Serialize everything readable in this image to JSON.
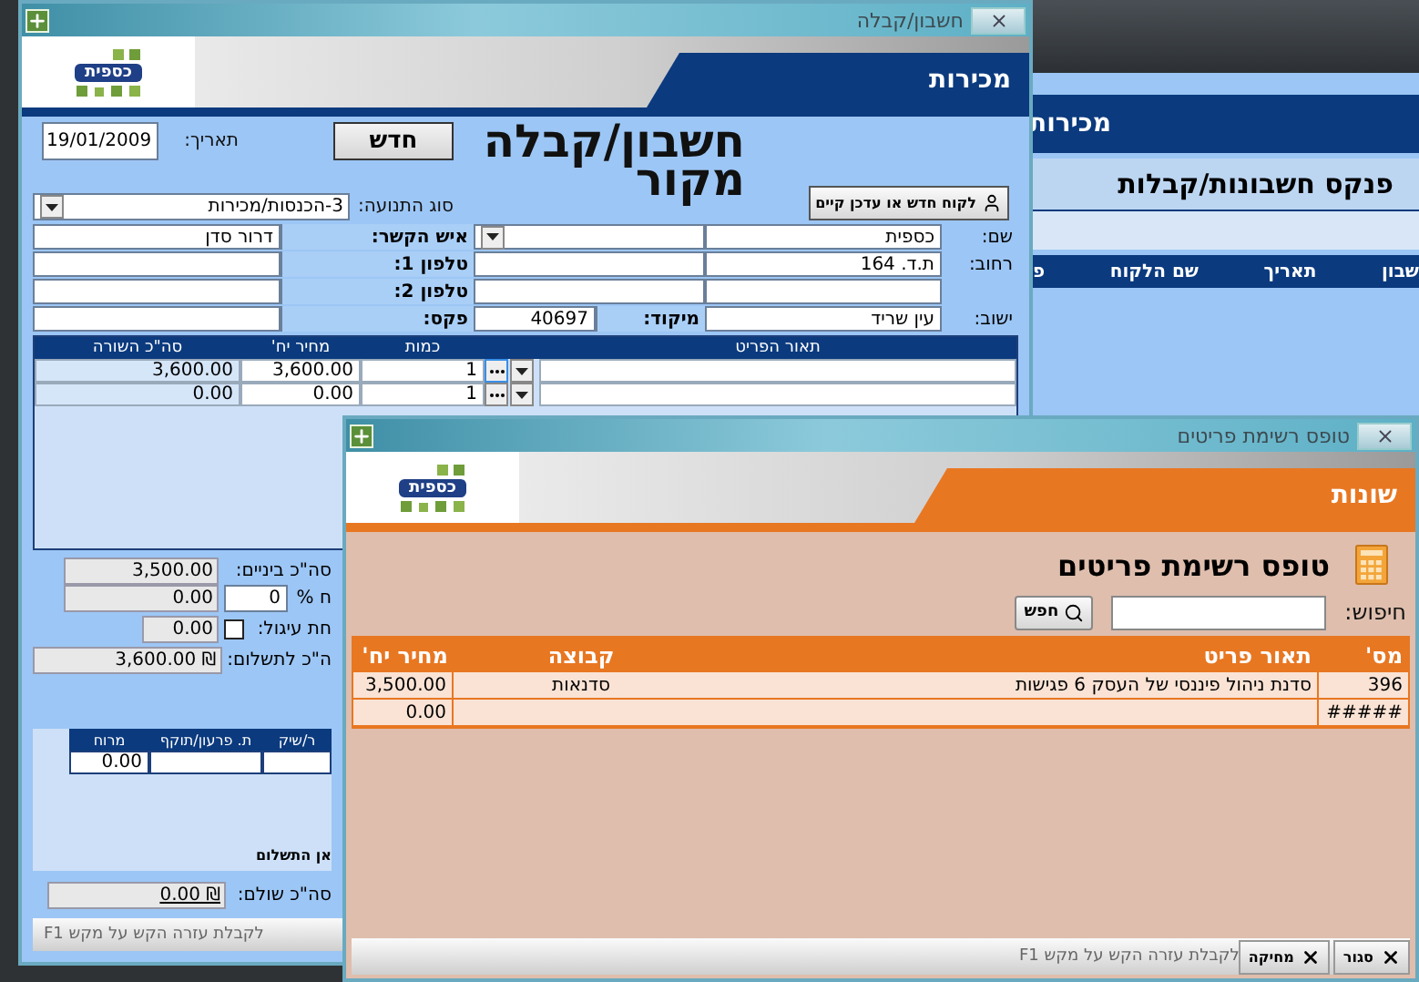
{
  "back_window": {
    "section": "מכירות",
    "heading": "פנקס חשבונות/קבלות",
    "columns": [
      "שבון",
      "תאריך",
      "שם הלקוח",
      "פ"
    ]
  },
  "invoice_window": {
    "title": "חשבון/קבלה",
    "logo_text": "כספית",
    "section": "מכירות",
    "date_label": "תאריך:",
    "date": "19/01/2009",
    "new_button": "חדש",
    "heading": "חשבון/קבלה מקור",
    "customer_button": "לקוח חדש או עדכן קיים",
    "movement_type": {
      "label": "סוג התנועה:",
      "value": "3-הכנסות/מכירות"
    },
    "customer_fields": [
      {
        "kind": "labeled",
        "label": "שם:",
        "value": "כספית"
      },
      {
        "kind": "labeled",
        "label": "רחוב:",
        "value": "ת.ד. 164"
      },
      {
        "kind": "blank"
      },
      {
        "kind": "labeled",
        "label": "ישוב:",
        "value": "עין שריד"
      }
    ],
    "zip": {
      "label": "מיקוד:",
      "value": "40697"
    },
    "contact_fields": [
      {
        "label": "איש הקשר:",
        "value": "דרור סדן"
      },
      {
        "label": "טלפון 1:"
      },
      {
        "label": "טלפון 2:"
      },
      {
        "label": "פקס:"
      }
    ],
    "line_columns": [
      "תאור הפריט",
      "כמות",
      "מחיר יח'",
      "סה\"כ השורה"
    ],
    "lines": [
      {
        "qty": "1",
        "price": "3,600.00",
        "total": "3,600.00"
      },
      {
        "qty": "1",
        "price": "0.00",
        "total": "0.00"
      }
    ],
    "totals": {
      "subtotal_label": "סה\"כ ביניים:",
      "subtotal": "3,500.00",
      "discount": "0.00",
      "percent": "0",
      "percent_label": "ח %",
      "rounding_label": "חת עיגול:",
      "rounding_checked": false,
      "rounding": "0.00",
      "payable_label": "ה\"כ לתשלום:",
      "payable": "3,600.00 ₪"
    },
    "payment_columns": [
      "ר/שיק",
      "ת. פרעון/תוקף",
      "מרוח"
    ],
    "payments": [
      {
        "amount": "0.00"
      }
    ],
    "payment_note": "אן התשלום",
    "paid_label": "סה\"כ שולם:",
    "paid": "0.00 ₪",
    "status": "לקבלת עזרה הקש על מקש F1"
  },
  "items_window": {
    "title": "טופס רשימת פריטים",
    "logo_text": "כספית",
    "section": "שונות",
    "heading": "טופס רשימת פריטים",
    "search_label": "חיפוש:",
    "search_button": "חפש",
    "columns": [
      "מס'",
      "תאור פריט",
      "קבוצה",
      "מחיר יח'"
    ],
    "rows": [
      {
        "number": "396",
        "description": "סדנת ניהול פיננסי של העסק  6 פגישות",
        "group": "סדנאות",
        "price": "3,500.00"
      },
      {
        "number": "#####",
        "price": "0.00"
      }
    ],
    "status": "לקבלת עזרה הקש על מקש F1",
    "buttons": [
      "סגור",
      "מחיקה"
    ]
  }
}
